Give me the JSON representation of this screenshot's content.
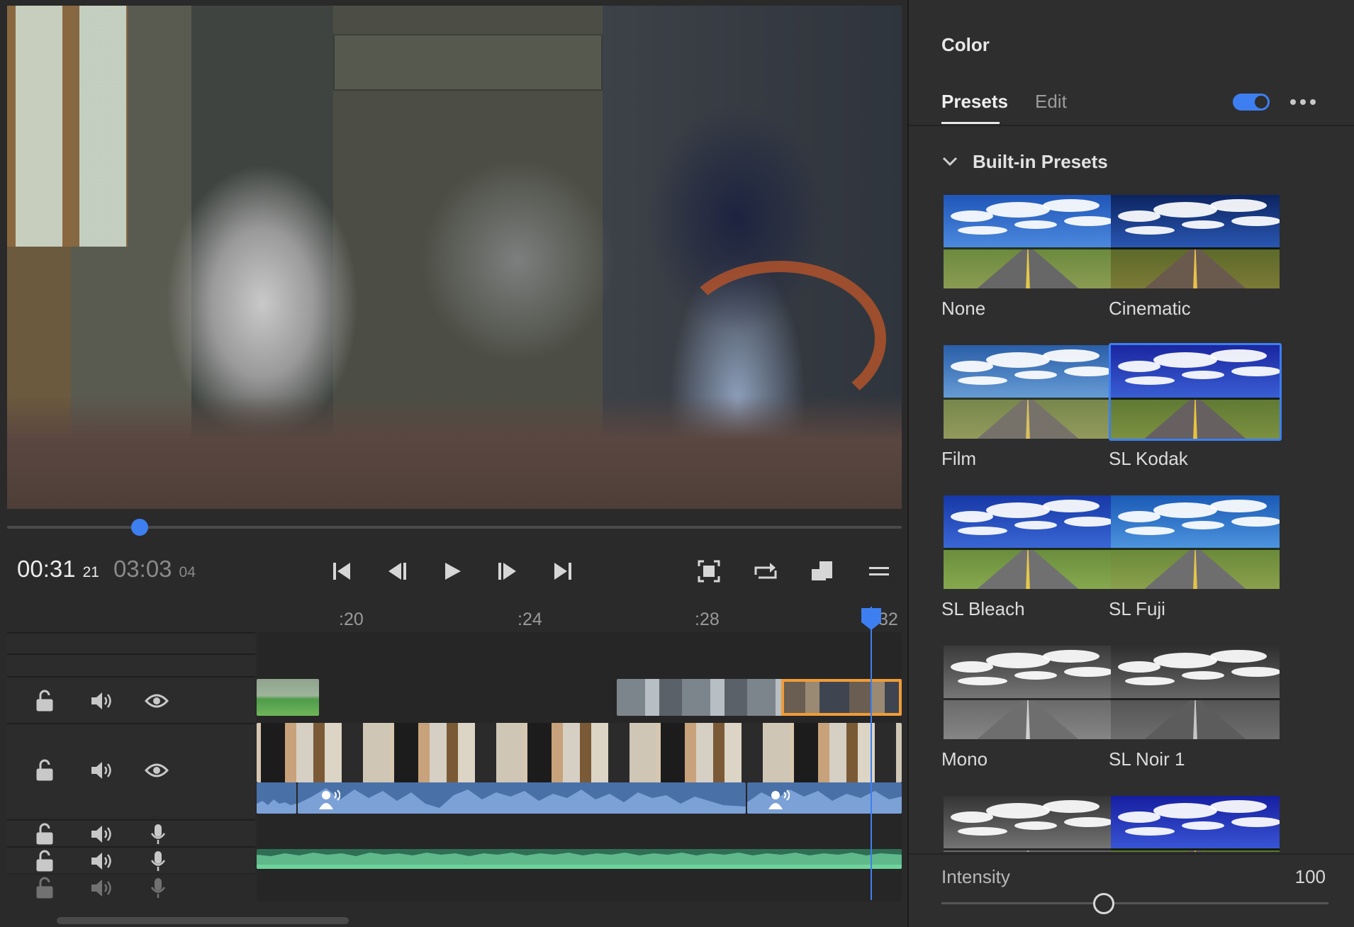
{
  "player": {
    "current_time": "00:31",
    "current_frames": "21",
    "duration": "03:03",
    "duration_frames": "04",
    "scrub_position": 0.148
  },
  "ruler": {
    "labels": [
      ":20",
      ":24",
      ":28",
      ":32"
    ]
  },
  "panel": {
    "title": "Color",
    "tabs": [
      {
        "label": "Presets",
        "active": true
      },
      {
        "label": "Edit",
        "active": false
      }
    ],
    "toggle_on": true,
    "section_label": "Built-in Presets",
    "presets": [
      {
        "label": "None",
        "style": "normal",
        "selected": false
      },
      {
        "label": "Cinematic",
        "style": "cinematic",
        "selected": false
      },
      {
        "label": "Film",
        "style": "film",
        "selected": false
      },
      {
        "label": "SL Kodak",
        "style": "kodak",
        "selected": true
      },
      {
        "label": "SL Bleach",
        "style": "bleach",
        "selected": false
      },
      {
        "label": "SL Fuji",
        "style": "fuji",
        "selected": false
      },
      {
        "label": "Mono",
        "style": "mono",
        "selected": false
      },
      {
        "label": "SL Noir 1",
        "style": "noir",
        "selected": false
      },
      {
        "label": "",
        "style": "mono2",
        "selected": false
      },
      {
        "label": "",
        "style": "kodak2",
        "selected": false
      }
    ],
    "intensity_label": "Intensity",
    "intensity_value": "100",
    "intensity_fraction": 0.42
  },
  "colors": {
    "accent": "#3d7ff0",
    "selected_clip_border": "#f09c38",
    "audio_clip": "#4a70a8",
    "music_clip": "#2f6e54"
  }
}
